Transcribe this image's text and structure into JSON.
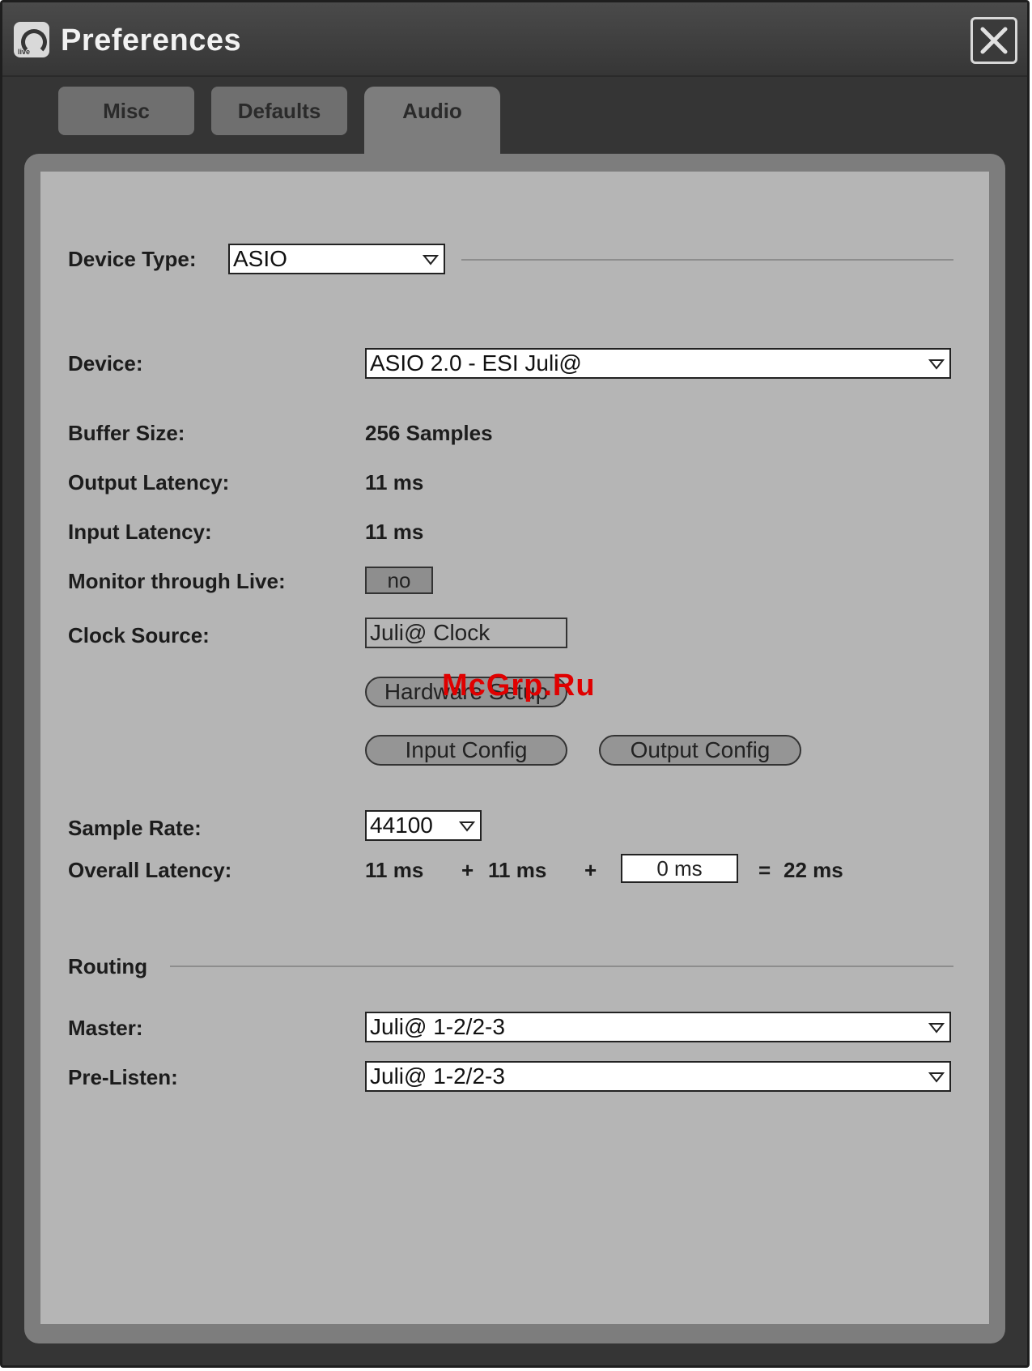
{
  "window": {
    "title": "Preferences"
  },
  "tabs": [
    "Misc",
    "Defaults",
    "Audio"
  ],
  "device_type": {
    "label": "Device Type:",
    "value": "ASIO"
  },
  "device": {
    "label": "Device:",
    "value": "ASIO 2.0 - ESI Juli@"
  },
  "buffer_size": {
    "label": "Buffer Size:",
    "value": "256 Samples"
  },
  "output_latency": {
    "label": "Output Latency:",
    "value": "11 ms"
  },
  "input_latency": {
    "label": "Input Latency:",
    "value": "11 ms"
  },
  "monitor": {
    "label": "Monitor through Live:",
    "value": "no"
  },
  "clock_source": {
    "label": "Clock Source:",
    "value": "Juli@ Clock"
  },
  "buttons": {
    "hardware_setup": "Hardware Setup",
    "input_config": "Input Config",
    "output_config": "Output Config"
  },
  "sample_rate": {
    "label": "Sample Rate:",
    "value": "44100"
  },
  "overall_latency": {
    "label": "Overall Latency:",
    "in": "11 ms",
    "plus1": "+",
    "out": "11 ms",
    "plus2": "+",
    "extra": "0 ms",
    "equals": "=",
    "total": "22 ms"
  },
  "routing": {
    "heading": "Routing",
    "master_label": "Master:",
    "master_value": "Juli@ 1-2/2-3",
    "prelisten_label": "Pre-Listen:",
    "prelisten_value": "Juli@ 1-2/2-3"
  },
  "watermark": "McGrp.Ru",
  "icons": {
    "app": "live-app-icon",
    "close": "close-icon",
    "dropdown": "chevron-down-icon"
  }
}
